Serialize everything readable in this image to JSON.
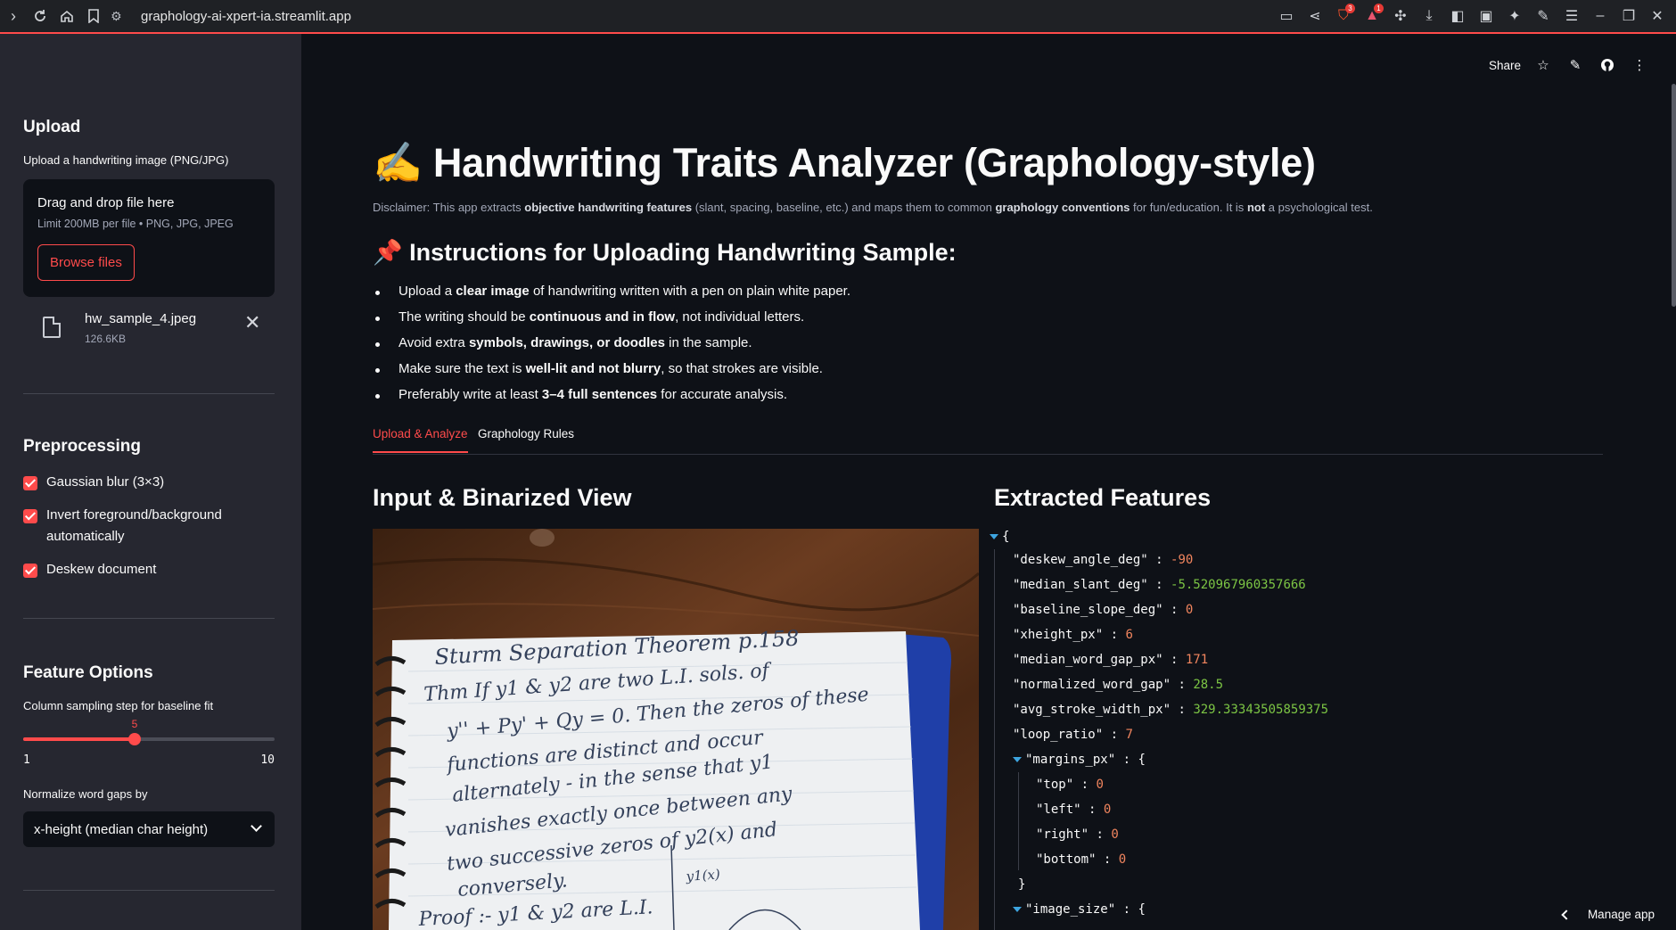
{
  "browser": {
    "url": "graphology-ai-xpert-ia.streamlit.app",
    "shield_badge": "3",
    "alert_badge": "1"
  },
  "sidebar": {
    "upload": {
      "heading": "Upload",
      "label": "Upload a handwriting image (PNG/JPG)",
      "dropzone_text": "Drag and drop file here",
      "limit_text": "Limit 200MB per file • PNG, JPG, JPEG",
      "browse_label": "Browse files",
      "file_name": "hw_sample_4.jpeg",
      "file_size": "126.6KB"
    },
    "preprocessing": {
      "heading": "Preprocessing",
      "options": [
        {
          "label": "Gaussian blur (3×3)",
          "checked": true
        },
        {
          "label": "Invert foreground/background automatically",
          "checked": true
        },
        {
          "label": "Deskew document",
          "checked": true
        }
      ]
    },
    "feature_options": {
      "heading": "Feature Options",
      "slider_label": "Column sampling step for baseline fit",
      "slider_value": 5,
      "slider_min": 1,
      "slider_max": 10,
      "select_label": "Normalize word gaps by",
      "select_value": "x-height (median char height)"
    }
  },
  "toolbar": {
    "share_label": "Share"
  },
  "main": {
    "title": "✍️ Handwriting Traits Analyzer (Graphology-style)",
    "disclaimer": {
      "p1": "Disclaimer: This app extracts ",
      "b1": "objective handwriting features",
      "p2": " (slant, spacing, baseline, etc.) and maps them to common ",
      "b2": "graphology conventions",
      "p3": " for fun/education. It is ",
      "b3": "not",
      "p4": " a psychological test."
    },
    "instructions_heading": "📌 Instructions for Uploading Handwriting Sample:",
    "instructions": [
      {
        "pre": "Upload a ",
        "bold": "clear image",
        "post": " of handwriting written with a pen on plain white paper."
      },
      {
        "pre": "The writing should be ",
        "bold": "continuous and in flow",
        "post": ", not individual letters."
      },
      {
        "pre": "Avoid extra ",
        "bold": "symbols, drawings, or doodles",
        "post": " in the sample."
      },
      {
        "pre": "Make sure the text is ",
        "bold": "well-lit and not blurry",
        "post": ", so that strokes are visible."
      },
      {
        "pre": "Preferably write at least ",
        "bold": "3–4 full sentences",
        "post": " for accurate analysis."
      }
    ],
    "tabs": [
      {
        "label": "Upload & Analyze",
        "active": true
      },
      {
        "label": "Graphology Rules",
        "active": false
      }
    ],
    "left_heading": "Input & Binarized View",
    "right_heading": "Extracted Features",
    "handwriting_lines": [
      "Sturm Separation Theorem   p.158",
      "Thm If y1 & y2 are two L.I. sols. of",
      "y'' + Py' + Qy = 0. Then the zeros of these",
      "functions are distinct and occur",
      "alternately - in the sense that y1",
      "vanishes exactly once between any",
      "two successive zeros of y2(x) and",
      "conversely.",
      "Proof :- y1 & y2 are L.I.",
      "y1(x)"
    ],
    "features": {
      "open_brace": "{",
      "rows": [
        {
          "key": "\"deskew_angle_deg\"",
          "value": "-90",
          "kind": "num"
        },
        {
          "key": "\"median_slant_deg\"",
          "value": "-5.520967960357666",
          "kind": "float"
        },
        {
          "key": "\"baseline_slope_deg\"",
          "value": "0",
          "kind": "num"
        },
        {
          "key": "\"xheight_px\"",
          "value": "6",
          "kind": "num"
        },
        {
          "key": "\"median_word_gap_px\"",
          "value": "171",
          "kind": "num"
        },
        {
          "key": "\"normalized_word_gap\"",
          "value": "28.5",
          "kind": "float"
        },
        {
          "key": "\"avg_stroke_width_px\"",
          "value": "329.33343505859375",
          "kind": "float"
        },
        {
          "key": "\"loop_ratio\"",
          "value": "7",
          "kind": "num"
        }
      ],
      "margins_key": "\"margins_px\"",
      "margins": [
        {
          "key": "\"top\"",
          "value": "0"
        },
        {
          "key": "\"left\"",
          "value": "0"
        },
        {
          "key": "\"right\"",
          "value": "0"
        },
        {
          "key": "\"bottom\"",
          "value": "0"
        }
      ],
      "image_size_key": "\"image_size\""
    }
  },
  "footer": {
    "manage_label": "Manage app"
  },
  "colors": {
    "accent": "#ff4b4b",
    "background": "#0e1117",
    "sidebar": "#262730",
    "json_number": "#f1855e",
    "json_float": "#7cc544"
  }
}
